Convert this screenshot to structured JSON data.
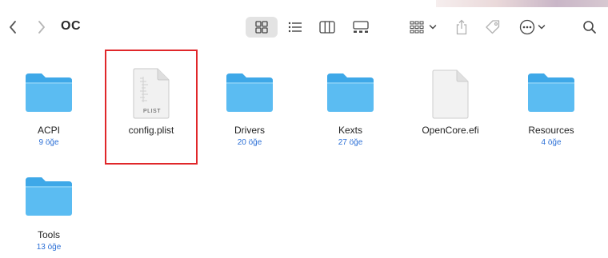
{
  "window": {
    "title": "OC"
  },
  "toolbar": {
    "back_icon": "chevron-left",
    "forward_icon": "chevron-right",
    "views": [
      "icon-view",
      "list-view",
      "column-view",
      "gallery-view"
    ],
    "group_icon": "group-by",
    "share_icon": "share",
    "tag_icon": "tag",
    "more_icon": "ellipsis-circle",
    "search_icon": "search"
  },
  "items": [
    {
      "name": "ACPI",
      "count": "9 öğe",
      "kind": "folder"
    },
    {
      "name": "config.plist",
      "count": "",
      "kind": "plist",
      "badge": "PLIST",
      "selected": true
    },
    {
      "name": "Drivers",
      "count": "20 öğe",
      "kind": "folder"
    },
    {
      "name": "Kexts",
      "count": "27 öğe",
      "kind": "folder"
    },
    {
      "name": "OpenCore.efi",
      "count": "",
      "kind": "file"
    },
    {
      "name": "Resources",
      "count": "4 öğe",
      "kind": "folder"
    },
    {
      "name": "Tools",
      "count": "13 öğe",
      "kind": "folder"
    }
  ],
  "colors": {
    "folder": "#5bbcf2",
    "folder_tab": "#3ea8e8",
    "count_text": "#2b6fd6",
    "selection_outline": "#e0272a"
  }
}
